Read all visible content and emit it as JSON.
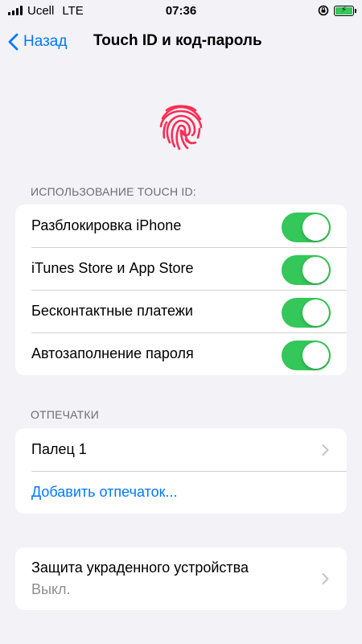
{
  "status_bar": {
    "carrier": "Ucell",
    "network": "LTE",
    "time": "07:36"
  },
  "nav": {
    "back_label": "Назад",
    "title": "Touch ID и код-пароль"
  },
  "touch_id_section": {
    "header": "ИСПОЛЬЗОВАНИЕ TOUCH ID:",
    "items": [
      {
        "label": "Разблокировка iPhone",
        "on": true
      },
      {
        "label": "iTunes Store и App Store",
        "on": true
      },
      {
        "label": "Бесконтактные платежи",
        "on": true
      },
      {
        "label": "Автозаполнение пароля",
        "on": true
      }
    ]
  },
  "fingerprints_section": {
    "header": "ОТПЕЧАТКИ",
    "finger_label": "Палец 1",
    "add_label": "Добавить отпечаток..."
  },
  "stolen_device": {
    "label": "Защита украденного устройства",
    "value": "Выкл."
  },
  "colors": {
    "accent": "#007aff",
    "toggle_on": "#34c759",
    "fingerprint": "#ff2d55",
    "background": "#f2f2f7"
  }
}
